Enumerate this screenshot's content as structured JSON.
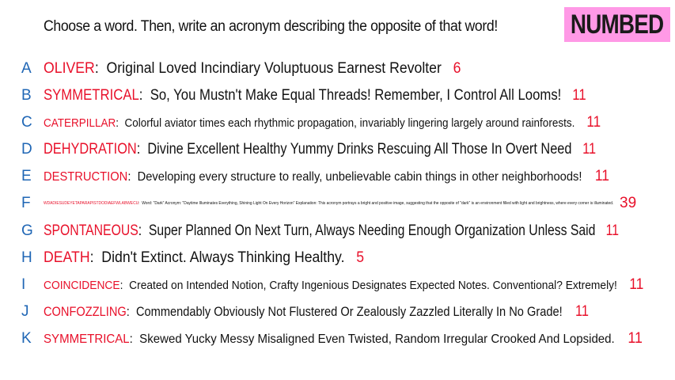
{
  "prompt": "Choose a word. Then, write an acronym describing the opposite of that word!",
  "badge": {
    "label": "NUMBED",
    "color": "#ff99e6"
  },
  "colors": {
    "letter": "#1f66b5",
    "word": "#e8102a",
    "count": "#e8102a",
    "text": "#111111"
  },
  "entries": [
    {
      "letter": "A",
      "word": "OLIVER",
      "acronym": "Original Loved Incindiary Voluptuous Earnest Revolter",
      "count": "6"
    },
    {
      "letter": "B",
      "word": "SYMMETRICAL",
      "acronym": "So, You Mustn't Make Equal Threads! Remember, I Control All Looms!",
      "count": "11"
    },
    {
      "letter": "C",
      "word": "CATERPILLAR",
      "acronym": "Colorful aviator times each rhythmic propagation, invariably lingering largely around rainforests.",
      "count": "11"
    },
    {
      "letter": "D",
      "word": "DEHYDRATION",
      "acronym": "Divine Excellent Healthy Yummy Drinks Rescuing All Those In Overt Need",
      "count": "11"
    },
    {
      "letter": "E",
      "word": "DESTRUCTION",
      "acronym": "Developing every structure to really, unbelievable cabin things in other neighborhoods!",
      "count": "11"
    },
    {
      "letter": "F",
      "word": "WDADIESUDEYETAPARAPISTDODIAEFWLABWECU",
      "acronym": "Word: \"Dark\" Acronym: \"Daytime Illuminates Everything, Shining Light On Every Horizon\"  Explanation: This acronym portrays a bright and positive image, suggesting that the opposite of \"dark\" is an environment filled with light and brightness, where every corner is illuminated.",
      "count": "39"
    },
    {
      "letter": "G",
      "word": "SPONTANEOUS",
      "acronym": "Super Planned On Next Turn, Always Needing Enough Organization Unless Said",
      "count": "11"
    },
    {
      "letter": "H",
      "word": "DEATH",
      "acronym": "Didn't Extinct. Always Thinking Healthy.",
      "count": "5"
    },
    {
      "letter": "I",
      "word": "COINCIDENCE",
      "acronym": "Created on Intended Notion, Crafty Ingenious Designates Expected Notes. Conventional? Extremely!",
      "count": "11"
    },
    {
      "letter": "J",
      "word": "CONFOZZLING",
      "acronym": "Commendably Obviously Not Flustered Or Zealously Zazzled Literally In No Grade!",
      "count": "11"
    },
    {
      "letter": "K",
      "word": "SYMMETRICAL",
      "acronym": "Skewed Yucky Messy Misaligned Even Twisted, Random Irregular Crooked And Lopsided.",
      "count": "11"
    }
  ]
}
